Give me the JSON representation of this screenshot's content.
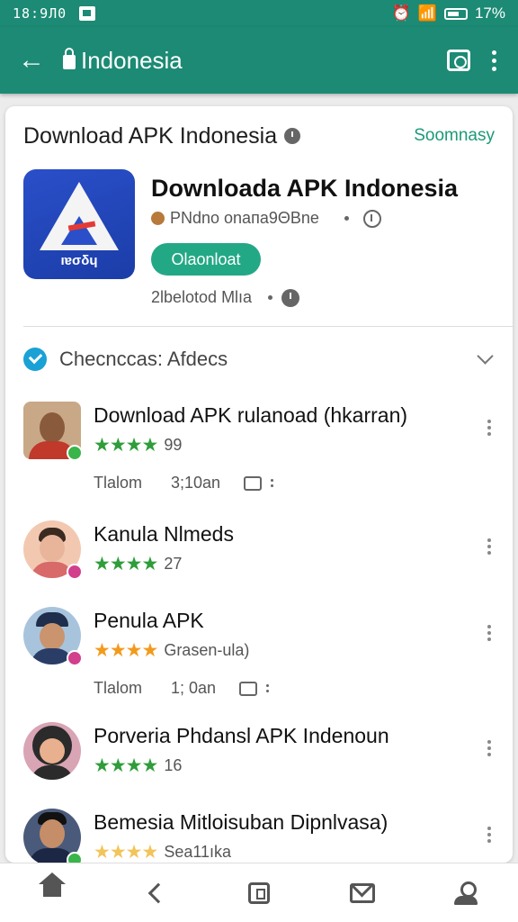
{
  "status_bar": {
    "time": "18:9Л0",
    "battery_text": "17%"
  },
  "app_bar": {
    "url": "Indonesia"
  },
  "header": {
    "title": "Download APK Indonesia",
    "see_more": "Soomnasy"
  },
  "app": {
    "icon_label": "ıɐσδɥ",
    "name": "Downloada APK Indonesia",
    "developer": "PNdno onaпа9ΘBne",
    "install_label": "Olaonloat",
    "meta": "2lbelotod Mlıa"
  },
  "section": {
    "title": "Checnccas: Afdecs"
  },
  "reviews": [
    {
      "name": "Download APK rulanoad (hkarran)",
      "stars": "★★★★",
      "count": "99",
      "meta_time": "Tlalom",
      "meta_date": "3;10an",
      "colors": {
        "face": "#8a5a3c",
        "bg": "#c9a887",
        "badge": "#3ab54a"
      },
      "star_color": "#2e9d3a"
    },
    {
      "name": "Kanula Nlmeds",
      "stars": "★★★★",
      "count": "27",
      "colors": {
        "face": "#e8b59a",
        "bg": "#f2c9b0",
        "badge": "#d23f8d"
      },
      "star_color": "#2e9d3a"
    },
    {
      "name": "Penula APK",
      "stars": "★★★★",
      "count": "Grasen-ula)",
      "meta_time": "Tlalom",
      "meta_date": "1; 0an",
      "colors": {
        "face": "#6b8fb8",
        "bg": "#a8c4dd",
        "badge": "#d23f8d"
      },
      "star_color": "#f39a1c"
    },
    {
      "name": "Porveria Phdansl APK Indenoun",
      "stars": "★★★★",
      "count": "16",
      "colors": {
        "face": "#2b2b2b",
        "bg": "#d9a4b4",
        "badge": "#3ab54a"
      },
      "star_color": "#2e9d3a"
    },
    {
      "name": "Bemesia Mitloisuban Dipnlvasa)",
      "stars": "★★★★",
      "count": "Sea11ıka",
      "colors": {
        "face": "#1c2746",
        "bg": "#4a5a7a",
        "badge": "#3ab54a"
      },
      "star_color": "#f2c45a"
    }
  ],
  "bottom_nav": [
    "home-icon",
    "back-icon",
    "store-icon",
    "mail-icon",
    "profile-icon"
  ]
}
